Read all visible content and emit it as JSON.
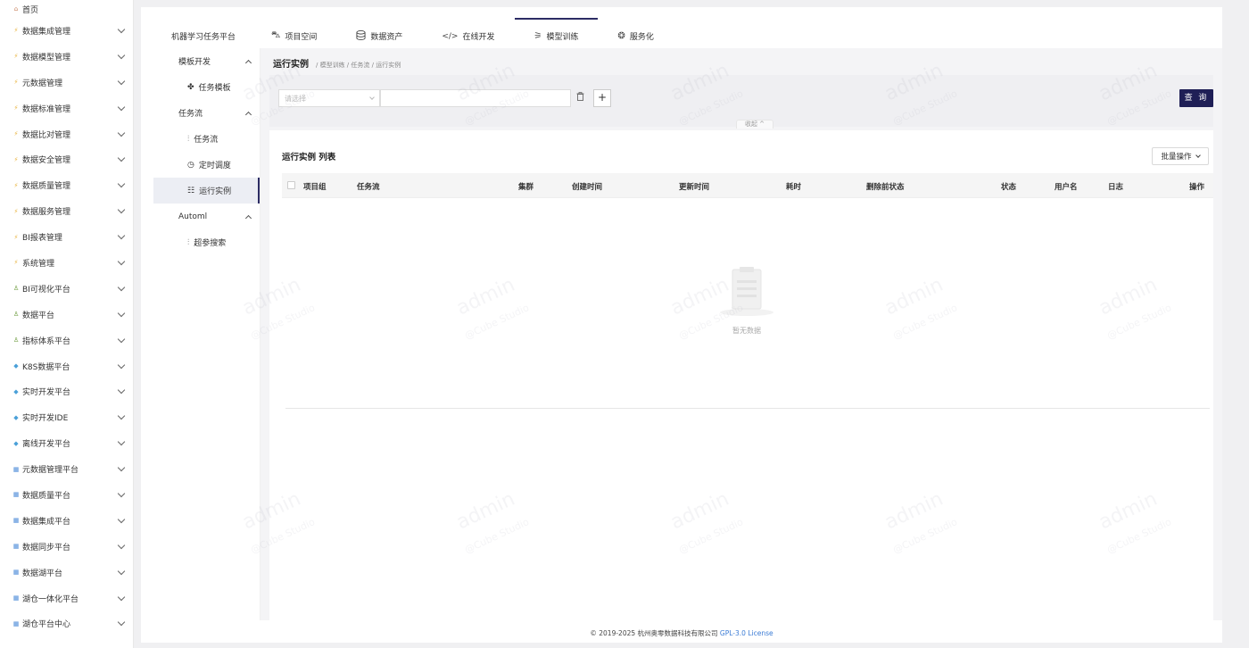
{
  "sidebar": {
    "home": {
      "label": "首页",
      "icon": "home-icon"
    },
    "items": [
      {
        "label": "数据集成管理",
        "icon": "bolt-icon"
      },
      {
        "label": "数据模型管理",
        "icon": "bolt-icon"
      },
      {
        "label": "元数据管理",
        "icon": "bolt-icon"
      },
      {
        "label": "数据标准管理",
        "icon": "bolt-icon"
      },
      {
        "label": "数据比对管理",
        "icon": "bolt-icon"
      },
      {
        "label": "数据安全管理",
        "icon": "bolt-icon"
      },
      {
        "label": "数据质量管理",
        "icon": "bolt-icon"
      },
      {
        "label": "数据服务管理",
        "icon": "bolt-icon"
      },
      {
        "label": "BI报表管理",
        "icon": "bolt-icon"
      },
      {
        "label": "系统管理",
        "icon": "bolt-icon"
      },
      {
        "label": "BI可视化平台",
        "icon": "person-icon"
      },
      {
        "label": "数据平台",
        "icon": "person-icon"
      },
      {
        "label": "指标体系平台",
        "icon": "person-icon"
      },
      {
        "label": "K8S数据平台",
        "icon": "diamond-icon"
      },
      {
        "label": "实时开发平台",
        "icon": "diamond-icon"
      },
      {
        "label": "实时开发IDE",
        "icon": "diamond-icon"
      },
      {
        "label": "离线开发平台",
        "icon": "diamond-icon"
      },
      {
        "label": "元数据管理平台",
        "icon": "grid-icon"
      },
      {
        "label": "数据质量平台",
        "icon": "grid-icon"
      },
      {
        "label": "数据集成平台",
        "icon": "grid-icon"
      },
      {
        "label": "数据同步平台",
        "icon": "grid-icon"
      },
      {
        "label": "数据湖平台",
        "icon": "grid-icon"
      },
      {
        "label": "湖仓一体化平台",
        "icon": "grid-icon"
      },
      {
        "label": "湖仓平台中心",
        "icon": "grid-icon"
      }
    ]
  },
  "topnav": {
    "platform_title": "机器学习任务平台",
    "tabs": [
      {
        "label": "项目空间",
        "icon": "car-icon"
      },
      {
        "label": "数据资产",
        "icon": "database-icon"
      },
      {
        "label": "在线开发",
        "icon": "code-icon"
      },
      {
        "label": "模型训练",
        "icon": "model-icon",
        "active": true
      },
      {
        "label": "服务化",
        "icon": "service-icon"
      }
    ]
  },
  "submenu": {
    "groups": [
      {
        "label": "模板开发",
        "items": [
          {
            "label": "任务模板",
            "icon": "puzzle-icon"
          }
        ]
      },
      {
        "label": "任务流",
        "items": [
          {
            "label": "任务流",
            "icon": "sliders-icon"
          },
          {
            "label": "定时调度",
            "icon": "clock-icon"
          },
          {
            "label": "运行实例",
            "icon": "instance-icon",
            "active": true
          }
        ]
      },
      {
        "label": "Automl",
        "items": [
          {
            "label": "超参搜索",
            "icon": "tune-icon"
          }
        ]
      }
    ]
  },
  "content": {
    "page_title": "运行实例",
    "breadcrumb": "/ 模型训练 / 任务流 / 运行实例",
    "filter": {
      "select_placeholder": "请选择",
      "query_label": "查 询",
      "collapse_label": "收起"
    },
    "list_title": "运行实例 列表",
    "batch_label": "批量操作",
    "columns": [
      "项目组",
      "任务流",
      "集群",
      "创建时间",
      "更新时间",
      "耗时",
      "删除前状态",
      "状态",
      "用户名",
      "日志",
      "操作"
    ],
    "empty_text": "暂无数据"
  },
  "footer": {
    "copyright": "© 2019-2025 杭州奥零数据科技有限公司",
    "license": "GPL-3.0 License"
  },
  "watermark": {
    "user": "admin",
    "brand": "@Cube Studio"
  },
  "colors": {
    "accent": "#1f1f56",
    "link": "#3a7bd5"
  }
}
